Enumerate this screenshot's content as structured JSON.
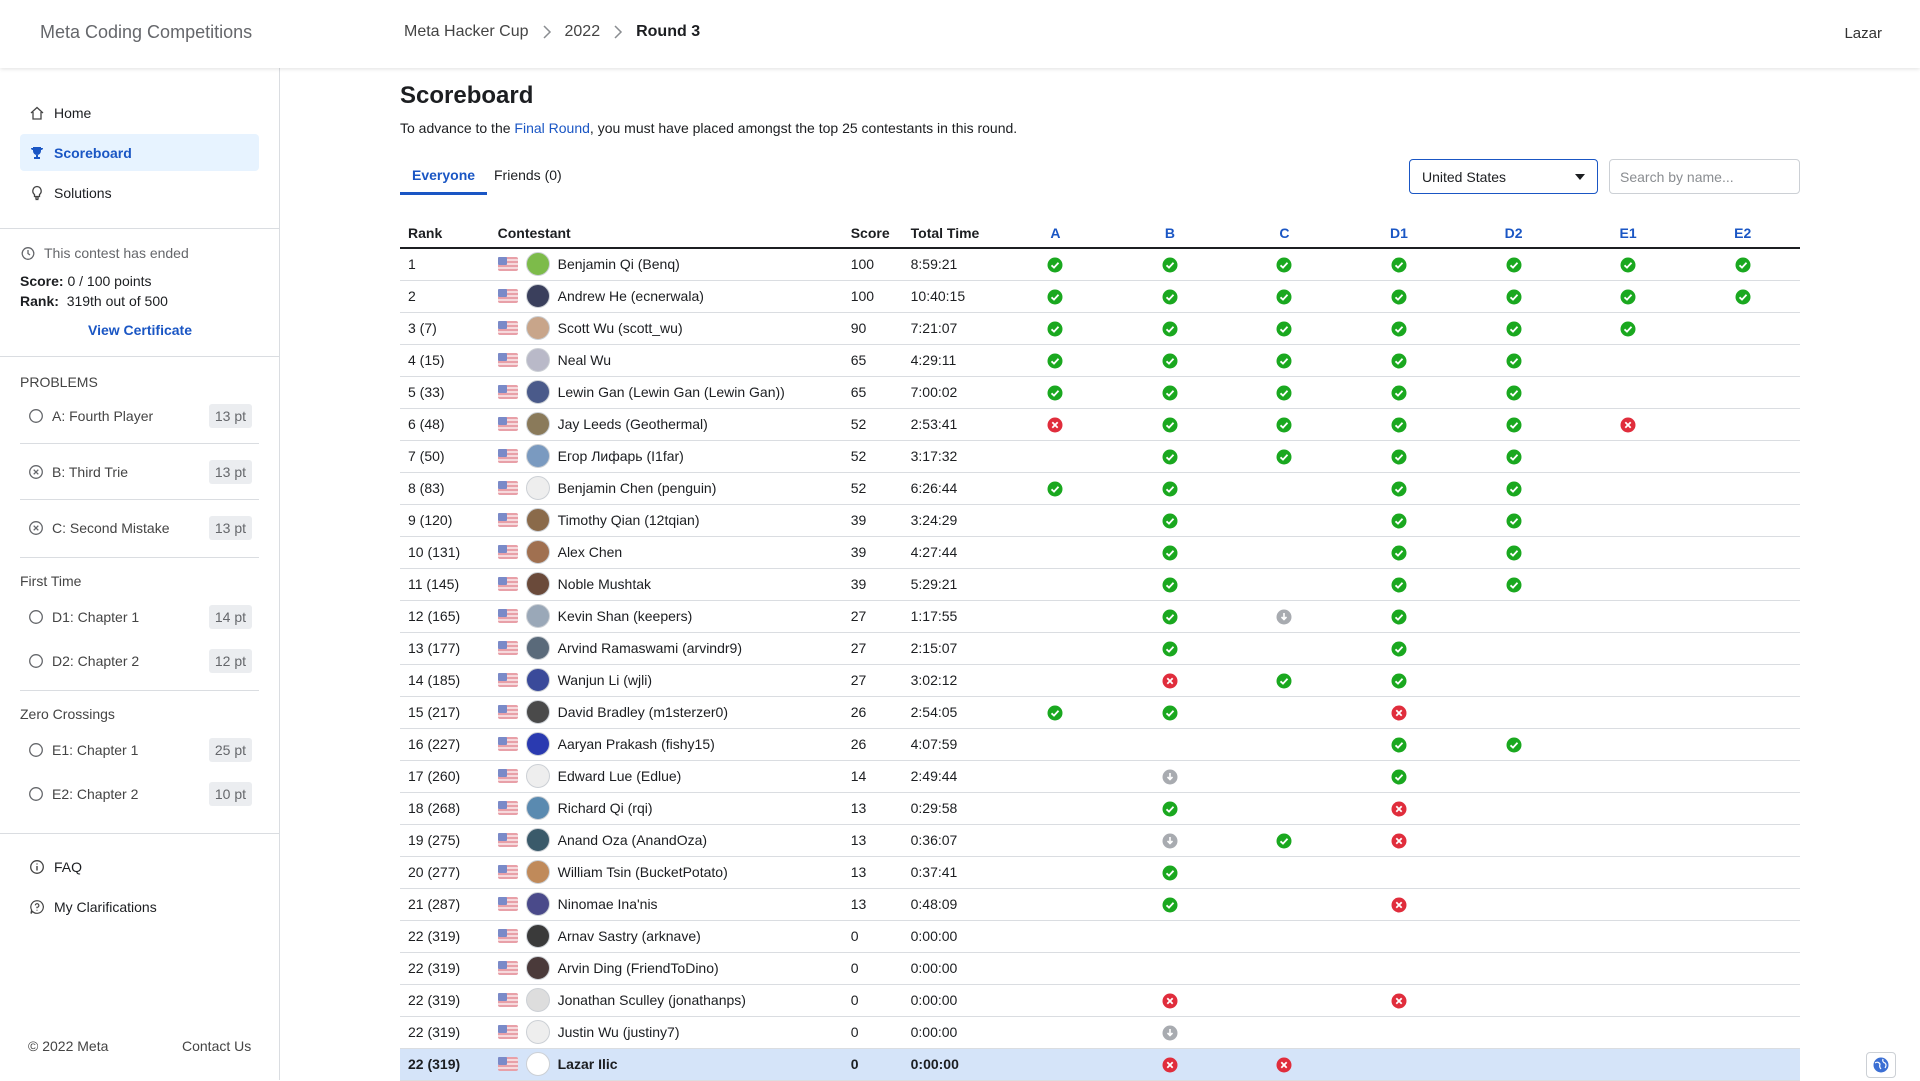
{
  "header": {
    "brand": "Meta Coding Competitions",
    "breadcrumbs": [
      "Meta Hacker Cup",
      "2022",
      "Round 3"
    ],
    "user": "Lazar"
  },
  "sidebar": {
    "nav": [
      {
        "label": "Home",
        "icon": "home-icon"
      },
      {
        "label": "Scoreboard",
        "icon": "trophy-icon"
      },
      {
        "label": "Solutions",
        "icon": "lightbulb-icon"
      }
    ],
    "status": "This contest has ended",
    "score_label": "Score:",
    "score_value": "0 / 100 points",
    "rank_label": "Rank:",
    "rank_value": "319th out of 500",
    "certificate": "View Certificate",
    "problems_heading": "PROBLEMS",
    "problems": [
      {
        "label": "A: Fourth Player",
        "pts": "13 pt",
        "status": "unattempted"
      },
      {
        "label": "B: Third Trie",
        "pts": "13 pt",
        "status": "wrong"
      },
      {
        "label": "C: Second Mistake",
        "pts": "13 pt",
        "status": "wrong"
      }
    ],
    "group1_heading": "First Time",
    "group1": [
      {
        "label": "D1: Chapter 1",
        "pts": "14 pt",
        "status": "unattempted"
      },
      {
        "label": "D2: Chapter 2",
        "pts": "12 pt",
        "status": "unattempted"
      }
    ],
    "group2_heading": "Zero Crossings",
    "group2": [
      {
        "label": "E1: Chapter 1",
        "pts": "25 pt",
        "status": "unattempted"
      },
      {
        "label": "E2: Chapter 2",
        "pts": "10 pt",
        "status": "unattempted"
      }
    ],
    "faq": "FAQ",
    "clarifications": "My Clarifications",
    "copyright": "© 2022 Meta",
    "contact": "Contact Us"
  },
  "main": {
    "title": "Scoreboard",
    "intro_before": "To advance to the ",
    "intro_link": "Final Round",
    "intro_after": ", you must have placed amongst the top 25 contestants in this round.",
    "tabs": [
      "Everyone",
      "Friends (0)"
    ],
    "country_select": "United States",
    "search_placeholder": "Search by name...",
    "columns": {
      "rank": "Rank",
      "contestant": "Contestant",
      "score": "Score",
      "time": "Total Time",
      "problems": [
        "A",
        "B",
        "C",
        "D1",
        "D2",
        "E1",
        "E2"
      ]
    }
  },
  "colors": {
    "accent": "#1a56c4",
    "accepted": "#1aa81f",
    "wrong": "#e02d3c",
    "pending": "#a8abb0",
    "me_row": "#d5e4f9"
  },
  "rows": [
    {
      "rank": "1",
      "name": "Benjamin Qi (Benq)",
      "score": "100",
      "time": "8:59:21",
      "avatar": "#7dbb4a",
      "p": [
        "ac",
        "ac",
        "ac",
        "ac",
        "ac",
        "ac",
        "ac"
      ]
    },
    {
      "rank": "2",
      "name": "Andrew He (ecnerwala)",
      "score": "100",
      "time": "10:40:15",
      "avatar": "#3a3f5c",
      "p": [
        "ac",
        "ac",
        "ac",
        "ac",
        "ac",
        "ac",
        "ac"
      ]
    },
    {
      "rank": "3 (7)",
      "name": "Scott Wu (scott_wu)",
      "score": "90",
      "time": "7:21:07",
      "avatar": "#c8a58a",
      "p": [
        "ac",
        "ac",
        "ac",
        "ac",
        "ac",
        "ac",
        ""
      ]
    },
    {
      "rank": "4 (15)",
      "name": "Neal Wu",
      "score": "65",
      "time": "4:29:11",
      "avatar": "#b9b9c8",
      "p": [
        "ac",
        "ac",
        "ac",
        "ac",
        "ac",
        "",
        ""
      ]
    },
    {
      "rank": "5 (33)",
      "name": "Lewin Gan (Lewin Gan (Lewin Gan))",
      "score": "65",
      "time": "7:00:02",
      "avatar": "#4a5a8a",
      "p": [
        "ac",
        "ac",
        "ac",
        "ac",
        "ac",
        "",
        ""
      ]
    },
    {
      "rank": "6 (48)",
      "name": "Jay Leeds (Geothermal)",
      "score": "52",
      "time": "2:53:41",
      "avatar": "#8a7a5a",
      "p": [
        "wa",
        "ac",
        "ac",
        "ac",
        "ac",
        "wa",
        ""
      ]
    },
    {
      "rank": "7 (50)",
      "name": "Егор Лифарь (I1far)",
      "score": "52",
      "time": "3:17:32",
      "avatar": "#7a9ac0",
      "p": [
        "",
        "ac",
        "ac",
        "ac",
        "ac",
        "",
        ""
      ]
    },
    {
      "rank": "8 (83)",
      "name": "Benjamin Chen (penguin)",
      "score": "52",
      "time": "6:26:44",
      "avatar": "#eeeeee",
      "p": [
        "ac",
        "ac",
        "",
        "ac",
        "ac",
        "",
        ""
      ]
    },
    {
      "rank": "9 (120)",
      "name": "Timothy Qian (12tqian)",
      "score": "39",
      "time": "3:24:29",
      "avatar": "#8a6a4a",
      "p": [
        "",
        "ac",
        "",
        "ac",
        "ac",
        "",
        ""
      ]
    },
    {
      "rank": "10 (131)",
      "name": "Alex Chen",
      "score": "39",
      "time": "4:27:44",
      "avatar": "#a07050",
      "p": [
        "",
        "ac",
        "",
        "ac",
        "ac",
        "",
        ""
      ]
    },
    {
      "rank": "11 (145)",
      "name": "Noble Mushtak",
      "score": "39",
      "time": "5:29:21",
      "avatar": "#6a4a3a",
      "p": [
        "",
        "ac",
        "",
        "ac",
        "ac",
        "",
        ""
      ]
    },
    {
      "rank": "12 (165)",
      "name": "Kevin Shan (keepers)",
      "score": "27",
      "time": "1:17:55",
      "avatar": "#9aa8b8",
      "p": [
        "",
        "ac",
        "pd",
        "ac",
        "",
        "",
        ""
      ]
    },
    {
      "rank": "13 (177)",
      "name": "Arvind Ramaswami (arvindr9)",
      "score": "27",
      "time": "2:15:07",
      "avatar": "#5a6a7a",
      "p": [
        "",
        "ac",
        "",
        "ac",
        "",
        "",
        ""
      ]
    },
    {
      "rank": "14 (185)",
      "name": "Wanjun Li (wjli)",
      "score": "27",
      "time": "3:02:12",
      "avatar": "#3a4a9a",
      "p": [
        "",
        "wa",
        "ac",
        "ac",
        "",
        "",
        ""
      ]
    },
    {
      "rank": "15 (217)",
      "name": "David Bradley (m1sterzer0)",
      "score": "26",
      "time": "2:54:05",
      "avatar": "#4a4a4a",
      "p": [
        "ac",
        "ac",
        "",
        "wa",
        "",
        "",
        ""
      ]
    },
    {
      "rank": "16 (227)",
      "name": "Aaryan Prakash (fishy15)",
      "score": "26",
      "time": "4:07:59",
      "avatar": "#2a3ab0",
      "p": [
        "",
        "",
        "",
        "ac",
        "ac",
        "",
        ""
      ]
    },
    {
      "rank": "17 (260)",
      "name": "Edward Lue (Edlue)",
      "score": "14",
      "time": "2:49:44",
      "avatar": "#eeeeee",
      "p": [
        "",
        "pd",
        "",
        "ac",
        "",
        "",
        ""
      ]
    },
    {
      "rank": "18 (268)",
      "name": "Richard Qi (rqi)",
      "score": "13",
      "time": "0:29:58",
      "avatar": "#5a8ab0",
      "p": [
        "",
        "ac",
        "",
        "wa",
        "",
        "",
        ""
      ]
    },
    {
      "rank": "19 (275)",
      "name": "Anand Oza (AnandOza)",
      "score": "13",
      "time": "0:36:07",
      "avatar": "#3a5a6a",
      "p": [
        "",
        "pd",
        "ac",
        "wa",
        "",
        "",
        ""
      ]
    },
    {
      "rank": "20 (277)",
      "name": "William Tsin (BucketPotato)",
      "score": "13",
      "time": "0:37:41",
      "avatar": "#c08a5a",
      "p": [
        "",
        "ac",
        "",
        "",
        "",
        "",
        ""
      ]
    },
    {
      "rank": "21 (287)",
      "name": "Ninomae Ina'nis",
      "score": "13",
      "time": "0:48:09",
      "avatar": "#4a4a8a",
      "p": [
        "",
        "ac",
        "",
        "wa",
        "",
        "",
        ""
      ]
    },
    {
      "rank": "22 (319)",
      "name": "Arnav Sastry (arknave)",
      "score": "0",
      "time": "0:00:00",
      "avatar": "#3a3a3a",
      "p": [
        "",
        "",
        "",
        "",
        "",
        "",
        ""
      ]
    },
    {
      "rank": "22 (319)",
      "name": "Arvin Ding (FriendToDino)",
      "score": "0",
      "time": "0:00:00",
      "avatar": "#4a3a3a",
      "p": [
        "",
        "",
        "",
        "",
        "",
        "",
        ""
      ]
    },
    {
      "rank": "22 (319)",
      "name": "Jonathan Sculley (jonathanps)",
      "score": "0",
      "time": "0:00:00",
      "avatar": "#dddddd",
      "p": [
        "",
        "wa",
        "",
        "wa",
        "",
        "",
        ""
      ]
    },
    {
      "rank": "22 (319)",
      "name": "Justin Wu (justiny7)",
      "score": "0",
      "time": "0:00:00",
      "avatar": "#eeeeee",
      "p": [
        "",
        "pd",
        "",
        "",
        "",
        "",
        ""
      ]
    },
    {
      "rank": "22 (319)",
      "name": "Lazar Ilic",
      "score": "0",
      "time": "0:00:00",
      "avatar": "#ffffff",
      "me": true,
      "p": [
        "",
        "wa",
        "wa",
        "",
        "",
        "",
        ""
      ]
    }
  ]
}
